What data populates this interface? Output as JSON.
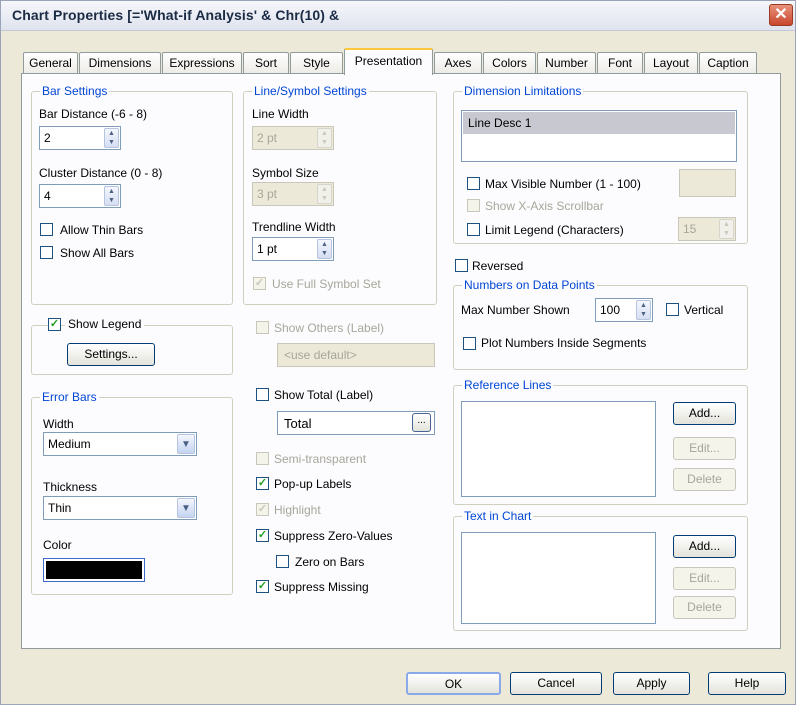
{
  "window": {
    "title": "Chart Properties [='What-if Analysis' & Chr(10) &",
    "close_glyph": "✕"
  },
  "tabs": [
    {
      "label": "General"
    },
    {
      "label": "Dimensions"
    },
    {
      "label": "Expressions"
    },
    {
      "label": "Sort"
    },
    {
      "label": "Style"
    },
    {
      "label": "Presentation"
    },
    {
      "label": "Axes"
    },
    {
      "label": "Colors"
    },
    {
      "label": "Number"
    },
    {
      "label": "Font"
    },
    {
      "label": "Layout"
    },
    {
      "label": "Caption"
    }
  ],
  "active_tab": "Presentation",
  "bar_settings": {
    "title": "Bar Settings",
    "bar_distance_label": "Bar Distance (-6 - 8)",
    "bar_distance_value": "2",
    "cluster_distance_label": "Cluster Distance (0 - 8)",
    "cluster_distance_value": "4",
    "allow_thin_bars": "Allow Thin Bars",
    "show_all_bars": "Show All Bars"
  },
  "legend": {
    "show_legend": "Show Legend",
    "settings_button": "Settings..."
  },
  "error_bars": {
    "title": "Error Bars",
    "width_label": "Width",
    "width_value": "Medium",
    "thickness_label": "Thickness",
    "thickness_value": "Thin",
    "color_label": "Color",
    "color_value": "#000000"
  },
  "line_symbol": {
    "title": "Line/Symbol Settings",
    "line_width_label": "Line Width",
    "line_width_value": "2 pt",
    "symbol_size_label": "Symbol Size",
    "symbol_size_value": "3 pt",
    "trendline_width_label": "Trendline Width",
    "trendline_width_value": "1 pt",
    "use_full_symbol_set": "Use Full Symbol Set"
  },
  "others": {
    "show_others": "Show Others (Label)",
    "others_placeholder": "<use default>",
    "show_total": "Show Total (Label)",
    "total_value": "Total",
    "ellipsis": "..."
  },
  "options": {
    "semi_transparent": "Semi-transparent",
    "popup_labels": "Pop-up Labels",
    "highlight": "Highlight",
    "suppress_zero": "Suppress Zero-Values",
    "zero_on_bars": "Zero on Bars",
    "suppress_missing": "Suppress Missing"
  },
  "dimension_limitations": {
    "title": "Dimension Limitations",
    "list_item": "Line Desc 1",
    "max_visible": "Max Visible Number (1 - 100)",
    "show_scrollbar": "Show X-Axis Scrollbar",
    "limit_legend": "Limit Legend (Characters)",
    "limit_legend_value": "15"
  },
  "reversed": "Reversed",
  "numbers_on_points": {
    "title": "Numbers on Data Points",
    "max_number_label": "Max Number Shown",
    "max_number_value": "100",
    "vertical": "Vertical",
    "plot_inside": "Plot Numbers Inside Segments"
  },
  "reference_lines": {
    "title": "Reference Lines",
    "add": "Add...",
    "edit": "Edit...",
    "delete": "Delete"
  },
  "text_in_chart": {
    "title": "Text in Chart",
    "add": "Add...",
    "edit": "Edit...",
    "delete": "Delete"
  },
  "footer": {
    "ok": "OK",
    "cancel": "Cancel",
    "apply": "Apply",
    "help": "Help"
  },
  "check_glyph": "✓"
}
